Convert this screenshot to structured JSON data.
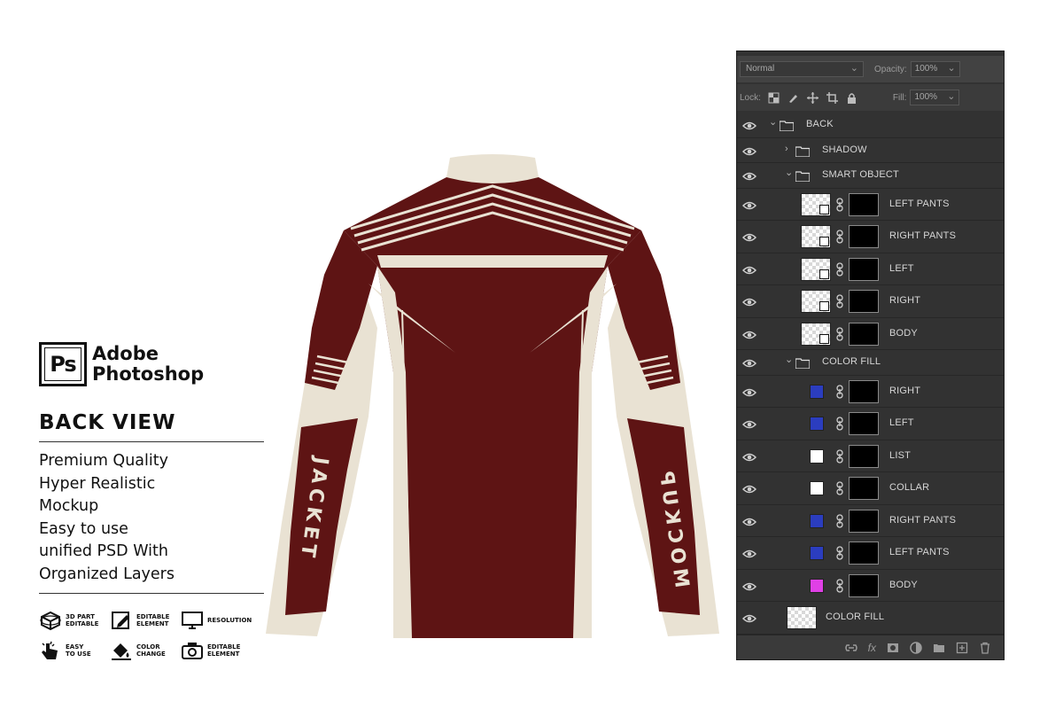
{
  "brand": {
    "logo_text": "Ps",
    "line1": "Adobe",
    "line2": "Photoshop"
  },
  "view_title": "BACK VIEW",
  "features": [
    "Premium Quality",
    "Hyper Realistic",
    "Mockup",
    "Easy to use",
    "unified PSD With",
    "Organized Layers"
  ],
  "badges": [
    {
      "icon": "3d-part-icon",
      "label": "3D PART\nEDITABLE"
    },
    {
      "icon": "edit-icon",
      "label": "EDITABLE\nELEMENT"
    },
    {
      "icon": "monitor-icon",
      "label": "RESOLUTION"
    },
    {
      "icon": "hand-touch-icon",
      "label": "EASY\nTO USE"
    },
    {
      "icon": "paint-bucket-icon",
      "label": "COLOR\nCHANGE"
    },
    {
      "icon": "camera-icon",
      "label": "EDITABLE\nELEMENT"
    }
  ],
  "jacket": {
    "left_sleeve_text": "JACKET",
    "right_sleeve_text": "MOCKUP",
    "colors": {
      "maroon": "#5e1414",
      "cream": "#e9e2d3"
    }
  },
  "panel": {
    "blend_mode": "Normal",
    "opacity_label": "Opacity:",
    "opacity_value": "100%",
    "lock_label": "Lock:",
    "fill_label": "Fill:",
    "fill_value": "100%",
    "layers": [
      {
        "name": "BACK",
        "kind": "group",
        "expanded": true
      },
      {
        "name": "SHADOW",
        "kind": "group",
        "expanded": false
      },
      {
        "name": "SMART OBJECT",
        "kind": "group",
        "expanded": true
      },
      {
        "name": "LEFT PANTS",
        "kind": "smart"
      },
      {
        "name": "RIGHT PANTS",
        "kind": "smart"
      },
      {
        "name": "LEFT",
        "kind": "smart"
      },
      {
        "name": "RIGHT",
        "kind": "smart"
      },
      {
        "name": "BODY",
        "kind": "smart"
      },
      {
        "name": "COLOR FILL",
        "kind": "group",
        "expanded": true
      },
      {
        "name": "RIGHT",
        "kind": "fill",
        "color": "#2b3dbf"
      },
      {
        "name": "LEFT",
        "kind": "fill",
        "color": "#2b3dbf"
      },
      {
        "name": "LIST",
        "kind": "fill",
        "color": "#ffffff"
      },
      {
        "name": "COLLAR",
        "kind": "fill",
        "color": "#ffffff"
      },
      {
        "name": "RIGHT PANTS",
        "kind": "fill",
        "color": "#2b3dbf"
      },
      {
        "name": "LEFT PANTS",
        "kind": "fill",
        "color": "#2b3dbf"
      },
      {
        "name": "BODY",
        "kind": "fill",
        "color": "#e040e6"
      },
      {
        "name": "COLOR FILL",
        "kind": "image"
      }
    ],
    "footer_icons": [
      "link-layers-icon",
      "fx-icon",
      "add-mask-icon",
      "adjustment-icon",
      "new-group-icon",
      "new-layer-icon",
      "delete-icon"
    ],
    "footer_fx": "fx"
  }
}
